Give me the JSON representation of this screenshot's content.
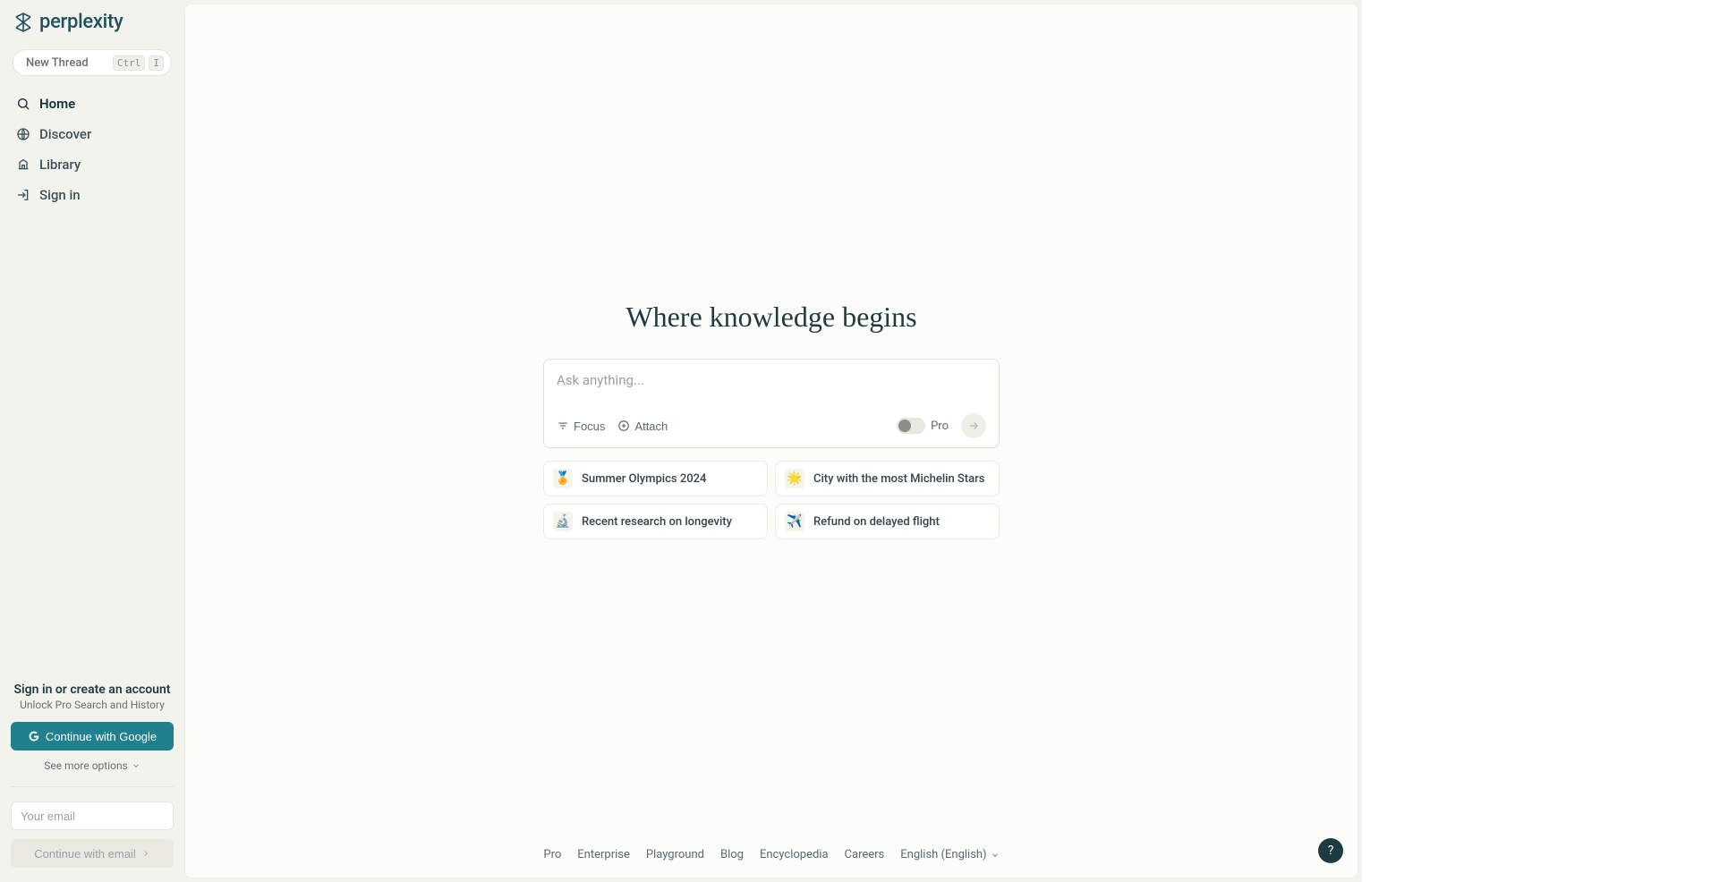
{
  "brand": {
    "name": "perplexity"
  },
  "sidebar": {
    "new_thread_label": "New Thread",
    "kbd_ctrl": "Ctrl",
    "kbd_i": "I",
    "nav": {
      "home": "Home",
      "discover": "Discover",
      "library": "Library",
      "signin": "Sign in"
    },
    "signin_block": {
      "title": "Sign in or create an account",
      "subtitle": "Unlock Pro Search and History",
      "google_label": "Continue with Google",
      "see_more": "See more options",
      "email_placeholder": "Your email",
      "email_btn": "Continue with email"
    }
  },
  "main": {
    "hero": "Where knowledge begins",
    "search_placeholder": "Ask anything...",
    "toolbar": {
      "focus": "Focus",
      "attach": "Attach",
      "pro": "Pro"
    },
    "suggestions": [
      {
        "emoji": "🏅",
        "text": "Summer Olympics 2024"
      },
      {
        "emoji": "🌟",
        "text": "City with the most Michelin Stars"
      },
      {
        "emoji": "🔬",
        "text": "Recent research on longevity"
      },
      {
        "emoji": "✈️",
        "text": "Refund on delayed flight"
      }
    ]
  },
  "footer": {
    "links": [
      "Pro",
      "Enterprise",
      "Playground",
      "Blog",
      "Encyclopedia",
      "Careers"
    ],
    "language": "English (English)"
  },
  "help": "?"
}
